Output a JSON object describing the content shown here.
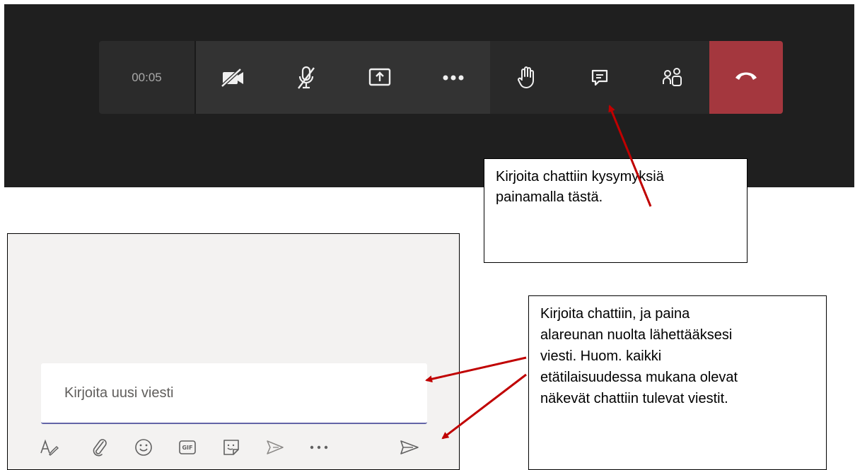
{
  "call_bar": {
    "timer": "00:05",
    "buttons": [
      {
        "name": "camera-off",
        "icon": "camera-off-icon"
      },
      {
        "name": "mic-off",
        "icon": "mic-off-icon"
      },
      {
        "name": "share-screen",
        "icon": "share-screen-icon"
      },
      {
        "name": "more-actions",
        "icon": "more-icon"
      },
      {
        "name": "raise-hand",
        "icon": "hand-icon"
      },
      {
        "name": "show-conversation",
        "icon": "chat-icon"
      },
      {
        "name": "show-participants",
        "icon": "participants-icon"
      },
      {
        "name": "hang-up",
        "icon": "phone-hangup-icon"
      }
    ],
    "colors": {
      "hangup": "#a4373e",
      "bar": "#2b2b2b",
      "background": "#1f1f1f"
    }
  },
  "callouts": {
    "chat_button": {
      "line1": "Kirjoita chattiin kysymyksiä",
      "line2": "painamalla tästä."
    },
    "send": {
      "line1": "Kirjoita chattiin, ja paina",
      "line2": "alareunan nuolta lähettääksesi",
      "line3": "viesti. Huom. kaikki",
      "line4": "etätilaisuudessa mukana olevat",
      "line5": "näkevät chattiin tulevat viestit."
    }
  },
  "chat": {
    "compose_placeholder": "Kirjoita uusi viesti",
    "toolbar": {
      "gif_label": "GIF",
      "icons": [
        "format-icon",
        "attach-icon",
        "emoji-icon",
        "gif-icon",
        "sticker-icon",
        "praise-icon",
        "more-icon",
        "send-icon"
      ]
    },
    "colors": {
      "accent": "#6264a7",
      "panel": "#f3f2f1"
    }
  },
  "annotation_color": "#c00000"
}
